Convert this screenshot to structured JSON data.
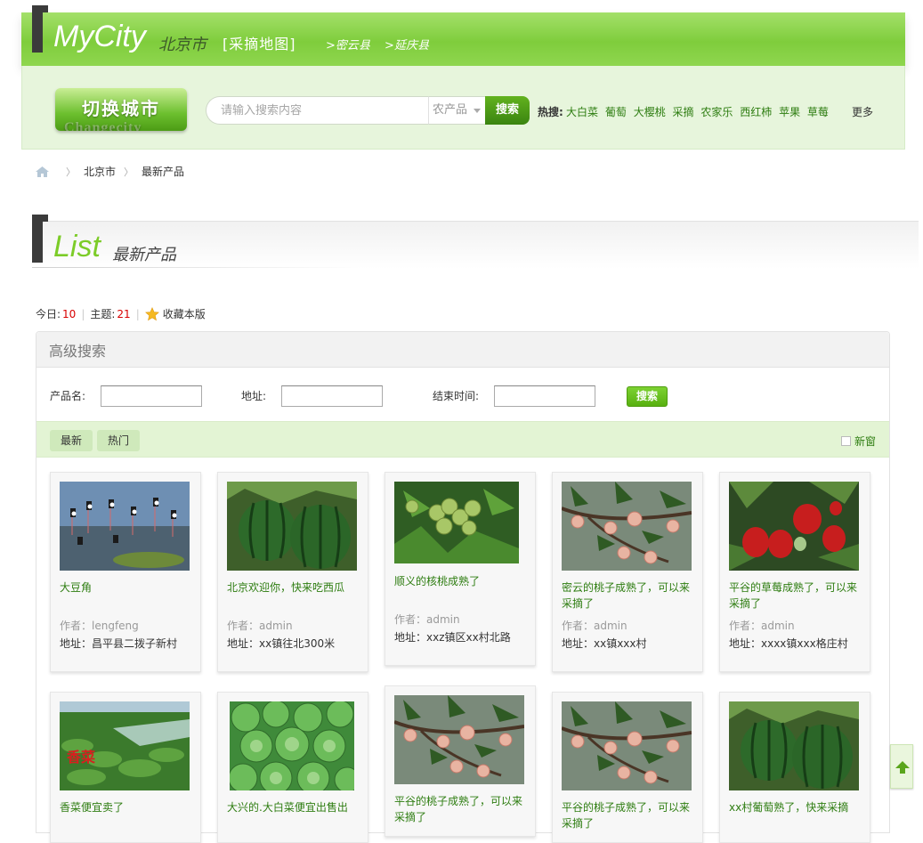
{
  "header": {
    "brand": "MyCity",
    "city": "北京市",
    "map_label": "[采摘地图]",
    "county_links": [
      ">密云县",
      ">延庆县"
    ]
  },
  "search": {
    "switch_city_label": "切换城市",
    "switch_city_ghost": "Changecity",
    "placeholder": "请输入搜索内容",
    "category": "农产品",
    "button": "搜索",
    "hot_label": "热搜:",
    "hot_terms": [
      "大白菜",
      "葡萄",
      "大樱桃",
      "采摘",
      "农家乐",
      "西红柿",
      "苹果",
      "草莓"
    ],
    "more": "更多"
  },
  "breadcrumb": {
    "items": [
      "北京市",
      "最新产品"
    ]
  },
  "list_header": {
    "title": "List",
    "subtitle": "最新产品"
  },
  "stats": {
    "today_label": "今日:",
    "today_value": "10",
    "topics_label": "主题:",
    "topics_value": "21",
    "favorite": "收藏本版"
  },
  "advanced": {
    "title": "高级搜索",
    "product_label": "产品名:",
    "address_label": "地址:",
    "end_time_label": "结束时间:",
    "search_button": "搜索",
    "tabs": [
      "最新",
      "热门"
    ],
    "new_window": "新窗"
  },
  "cards": [
    {
      "title": "大豆角",
      "author": "作者：lengfeng",
      "address": "地址：昌平县二拨子新村",
      "image": "birds"
    },
    {
      "title": "北京欢迎你，快来吃西瓜",
      "author": "作者：admin",
      "address": "地址：xx镇往北300米",
      "image": "watermelon"
    },
    {
      "title": "顺义的核桃成熟了",
      "author": "作者：admin",
      "address": "地址：xxz镇区xx村北路",
      "image": "walnut"
    },
    {
      "title": "密云的桃子成熟了，可以来采摘了",
      "author": "作者：admin",
      "address": "地址：xx镇xxx村",
      "image": "peach"
    },
    {
      "title": "平谷的草莓成熟了，可以来采摘了",
      "author": "作者：admin",
      "address": "地址：xxxx镇xxx格庄村",
      "image": "strawberry"
    },
    {
      "title": "香菜便宜卖了",
      "author": "",
      "address": "",
      "image": "coriander",
      "photo_text": "香菜"
    },
    {
      "title": "大兴的.大白菜便宜出售出",
      "author": "",
      "address": "",
      "image": "cabbage"
    },
    {
      "title": "平谷的桃子成熟了，可以来采摘了",
      "author": "",
      "address": "",
      "image": "peach"
    },
    {
      "title": "平谷的桃子成熟了，可以来采摘了",
      "author": "",
      "address": "",
      "image": "peach"
    },
    {
      "title": "xx村葡萄熟了，快来采摘",
      "author": "",
      "address": "",
      "image": "watermelon"
    }
  ],
  "colors": {
    "brand_green": "#7fcd3c",
    "link_green": "#2e7d11",
    "count_red": "#d80000"
  }
}
